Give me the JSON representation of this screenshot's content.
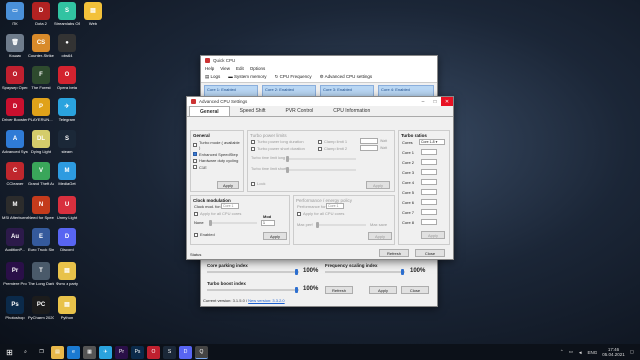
{
  "desktop_icons": [
    {
      "label": "ПК",
      "color": "#4a90d9",
      "glyph": "▭"
    },
    {
      "label": "Dota 2",
      "color": "#b22222",
      "glyph": "D"
    },
    {
      "label": "Streamlabs OBS",
      "color": "#31c3a2",
      "glyph": "S"
    },
    {
      "label": "Web",
      "color": "#f3c13a",
      "glyph": "▤"
    },
    {
      "label": "Кошик",
      "color": "#6f7c8c",
      "glyph": "🗑"
    },
    {
      "label": "Counter-Strike Global Offe...",
      "color": "#d88a2a",
      "glyph": "CS"
    },
    {
      "label": "obs64",
      "color": "#333",
      "glyph": "●"
    },
    {
      "label": "Spaysep Opera GX",
      "color": "#c0202f",
      "glyph": "O"
    },
    {
      "label": "The Forest",
      "color": "#2e4a2e",
      "glyph": "F"
    },
    {
      "label": "Opera beta",
      "color": "#d3232f",
      "glyph": "O"
    },
    {
      "label": "Driver Booster 8",
      "color": "#c8102e",
      "glyph": "D"
    },
    {
      "label": "PLAYERUN... BATTLEGR...",
      "color": "#e0a21a",
      "glyph": "P"
    },
    {
      "label": "Telegram",
      "color": "#2aa3de",
      "glyph": "✈"
    },
    {
      "label": "Advanced SystemCare",
      "color": "#2f7bd6",
      "glyph": "A"
    },
    {
      "label": "Dying Light",
      "color": "#d4cc6b",
      "glyph": "DL"
    },
    {
      "label": "steam",
      "color": "#1b2838",
      "glyph": "S"
    },
    {
      "label": "CCleaner",
      "color": "#c0272d",
      "glyph": "C"
    },
    {
      "label": "Grand Theft Auto V",
      "color": "#3aa65a",
      "glyph": "V"
    },
    {
      "label": "MediaGet",
      "color": "#2d9be0",
      "glyph": "M"
    },
    {
      "label": "MSI Afterburner",
      "color": "#2c2c2c",
      "glyph": "M"
    },
    {
      "label": "Need for Speed H...",
      "color": "#c43b1c",
      "glyph": "N"
    },
    {
      "label": "Unmy Light",
      "color": "#d8303e",
      "glyph": "U"
    },
    {
      "label": "AuditionP...",
      "color": "#2c1a4a",
      "glyph": "Au"
    },
    {
      "label": "Euro Truck Simulator 2",
      "color": "#355a9c",
      "glyph": "E"
    },
    {
      "label": "Discord",
      "color": "#5865f2",
      "glyph": "D"
    },
    {
      "label": "Premiere Pro",
      "color": "#2a0f48",
      "glyph": "Pr"
    },
    {
      "label": "The Long Dark",
      "color": "#4a5a6a",
      "glyph": "T"
    },
    {
      "label": "Фото з party",
      "color": "#e8c24a",
      "glyph": "▤"
    },
    {
      "label": "Photoshop",
      "color": "#0b2a4a",
      "glyph": "Ps"
    },
    {
      "label": "PyCharm 2020.3.5 x64",
      "color": "#1c1c1c",
      "glyph": "PC"
    },
    {
      "label": "Python",
      "color": "#e8c24a",
      "glyph": "▤"
    }
  ],
  "quickcpu": {
    "title": "Quick CPU",
    "menu": [
      "Help",
      "View",
      "Edit",
      "Options"
    ],
    "toolbar": [
      "Logs",
      "System memory",
      "CPU Frequency",
      "Advanced CPU settings"
    ],
    "cores": [
      "Core 1: Enabled",
      "Core 2: Enabled",
      "Core 3: Enabled",
      "Core 4: Enabled"
    ],
    "core_parking_label": "Core parking index",
    "core_parking_value": "100%",
    "freq_scaling_label": "Frequency scaling index",
    "freq_scaling_value": "100%",
    "turbo_boost_label": "Turbo boost index",
    "turbo_boost_value": "100%",
    "refresh": "Refresh",
    "apply": "Apply",
    "close": "Close",
    "version_label": "Current version:",
    "version": "3.1.5.0",
    "new_version": "New version: 3.3.2.0"
  },
  "adv": {
    "title": "Advanced CPU Settings",
    "tabs": [
      "General",
      "Speed Shift",
      "PVR Control",
      "CPU Information"
    ],
    "general": {
      "title": "General",
      "items": [
        {
          "label": "Turbo mode ( available )",
          "checked": false
        },
        {
          "label": "Enhanced SpeedStep",
          "checked": true
        },
        {
          "label": "Hardware duty cycling",
          "checked": false
        },
        {
          "label": "C1E",
          "checked": false
        }
      ],
      "apply": "Apply"
    },
    "turbo_limits": {
      "title": "Turbo power limits",
      "long_duration": "Turbo power long duration",
      "short_duration": "Turbo power short duration",
      "clamp1": "Clamp limit 1",
      "clamp2": "Clamp limit 2",
      "unit": "Watt",
      "long_limit": "Turbo time limit long",
      "short_limit": "Turbo time limit short",
      "lock": "Lock",
      "apply": "Apply"
    },
    "turbo_ratios": {
      "title": "Turbo ratios",
      "cores_label": "Cores",
      "cores_value": "Core 1-8",
      "rows": [
        "Core 1",
        "Core 2",
        "Core 3",
        "Core 4",
        "Core 5",
        "Core 6",
        "Core 7",
        "Core 8"
      ],
      "apply": "Apply"
    },
    "clock_mod": {
      "title": "Clock modulation",
      "clock_mod_for": "Clock mod. for:",
      "core_value": "Core 1",
      "apply_all": "Apply for all CPU cores",
      "mod_label": "Mod",
      "none": "None",
      "value": "1",
      "enabled": "Enabled",
      "apply": "Apply"
    },
    "perf_policy": {
      "title": "Performance / energy policy",
      "perf_for": "Performance for:",
      "core_value": "Core 1",
      "apply_all": "Apply for all CPU cores",
      "max_perf": "Max perf",
      "max_save": "Max save",
      "apply": "Apply"
    },
    "status_label": "Status",
    "refresh": "Refresh",
    "close": "Close"
  },
  "taskbar": {
    "time": "17:46",
    "date": "05.04.2021",
    "lang": "ENG"
  }
}
